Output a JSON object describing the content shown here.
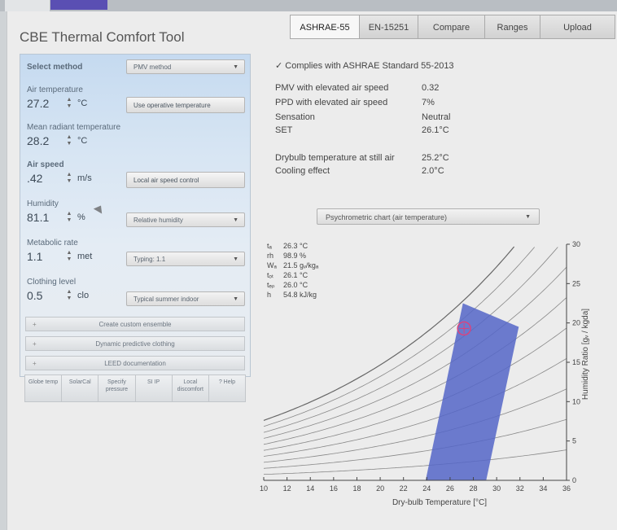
{
  "app": {
    "title": "CBE Thermal Comfort Tool"
  },
  "tabs": [
    "ASHRAE-55",
    "EN-15251",
    "Compare",
    "Ranges",
    "Upload"
  ],
  "inputs": {
    "method": {
      "label": "Select method",
      "value": "PMV method"
    },
    "air_temperature": {
      "label": "Air temperature",
      "value": "27.2",
      "unit": "°C",
      "button": "Use operative temperature"
    },
    "mean_radiant_temperature": {
      "label": "Mean radiant temperature",
      "value": "28.2",
      "unit": "°C"
    },
    "air_speed": {
      "label": "Air speed",
      "value": ".42",
      "unit": "m/s",
      "button": "Local air speed control"
    },
    "humidity": {
      "label": "Humidity",
      "value": "81.1",
      "unit": "%",
      "select": "Relative humidity"
    },
    "metabolic_rate": {
      "label": "Metabolic rate",
      "value": "1.1",
      "unit": "met",
      "select": "Typing: 1.1"
    },
    "clothing_level": {
      "label": "Clothing level",
      "value": "0.5",
      "unit": "clo",
      "select": "Typical summer indoor"
    }
  },
  "actions": {
    "create_ensemble": "Create custom ensemble",
    "dynamic_clothing": "Dynamic predictive clothing",
    "leed": "LEED documentation",
    "bottom": [
      "Globe temp",
      "SolarCal",
      "Specify pressure",
      "SI IP",
      "Local discomfort",
      "? Help"
    ]
  },
  "results": {
    "compliance": "✓  Complies with ASHRAE Standard 55-2013",
    "rows": [
      {
        "label": "PMV with elevated air speed",
        "value": "0.32"
      },
      {
        "label": "PPD with elevated air speed",
        "value": "7%"
      },
      {
        "label": "Sensation",
        "value": "Neutral"
      },
      {
        "label": "SET",
        "value": "26.1°C"
      },
      {
        "label": "Drybulb temperature at still air",
        "value": "25.2°C"
      },
      {
        "label": "Cooling effect",
        "value": "2.0°C"
      }
    ]
  },
  "chart_select": "Psychrometric chart (air temperature)",
  "readout": [
    {
      "sym": "tₐ",
      "value": "26.3 °C"
    },
    {
      "sym": "rh",
      "value": "98.9 %"
    },
    {
      "sym": "Wₐ",
      "value": "21.5 gᵥ/kgₐ"
    },
    {
      "sym": "tₒₜ",
      "value": "26.1 °C"
    },
    {
      "sym": "tₑₚ",
      "value": "26.0 °C"
    },
    {
      "sym": "h",
      "value": "54.8 kJ/kg"
    }
  ],
  "colors": {
    "comfort_zone": "#5566c8",
    "point": "#e0407a",
    "panel_blue": "#c5daf0"
  },
  "chart_data": {
    "type": "scatter",
    "xlabel": "Dry-bulb Temperature [°C]",
    "ylabel": "Humidity Ratio [gᵥ / kgda]",
    "xlim": [
      10,
      36
    ],
    "ylim": [
      0,
      30
    ],
    "xticks": [
      10,
      12,
      14,
      16,
      18,
      20,
      22,
      24,
      26,
      28,
      30,
      32,
      34,
      36
    ],
    "yticks": [
      0,
      5,
      10,
      15,
      20,
      25,
      30
    ],
    "comfort_zone_polygon": [
      [
        23.9,
        0
      ],
      [
        29.1,
        0
      ],
      [
        31.9,
        19.5
      ],
      [
        27.1,
        22.5
      ]
    ],
    "point": {
      "x": 27.2,
      "y": 19.3
    },
    "rh_curves_percent": [
      10,
      20,
      30,
      40,
      50,
      60,
      70,
      80,
      90,
      100
    ]
  }
}
